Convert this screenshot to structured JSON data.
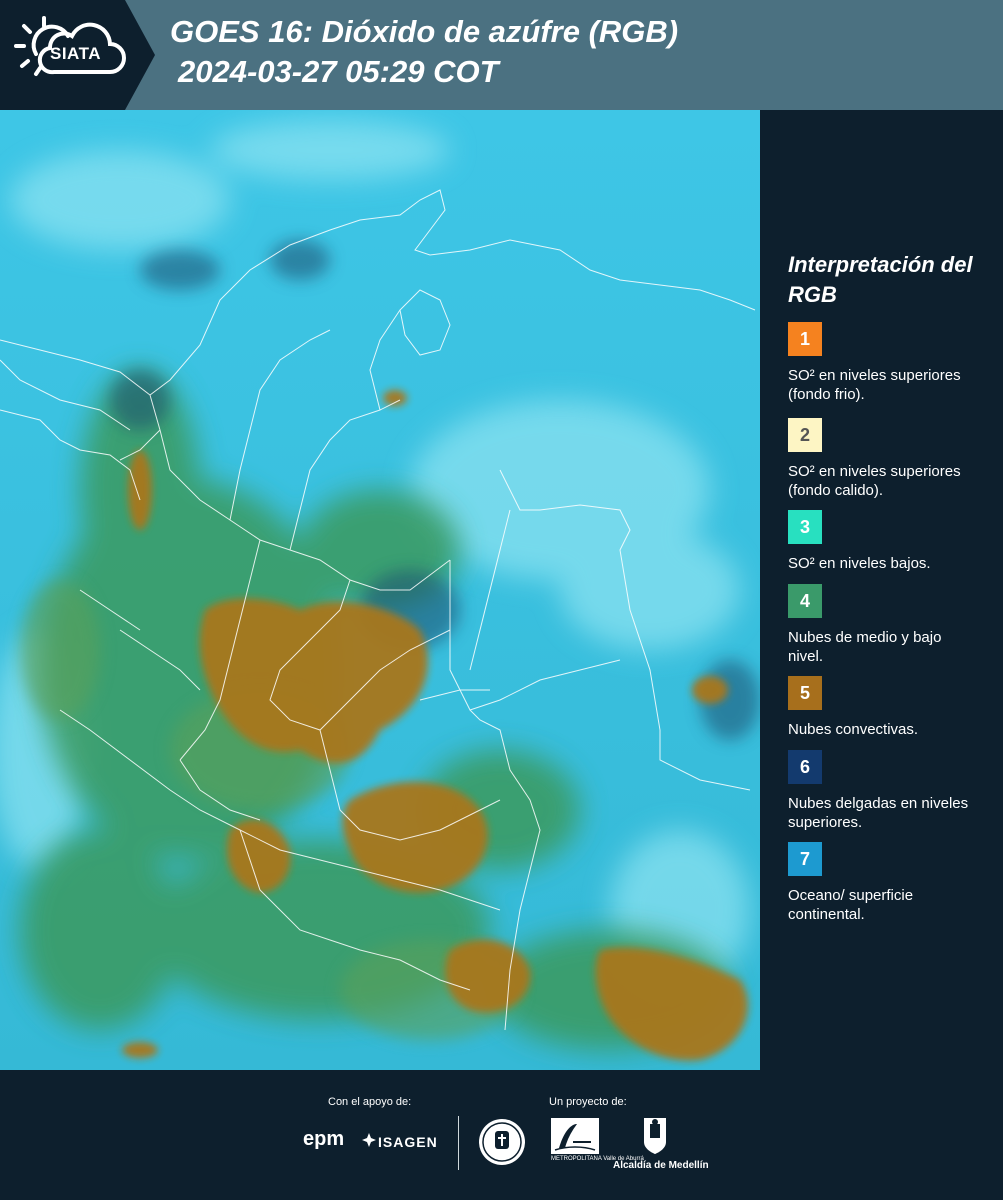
{
  "header": {
    "logo_text": "SIATA",
    "title": "GOES 16: Dióxido de azúfre (RGB)",
    "subtitle": " 2024-03-27 05:29 COT"
  },
  "legend": {
    "title": "Interpretación del RGB",
    "items": [
      {
        "number": "1",
        "label": "SO² en niveles superiores (fondo frio).",
        "color": "#f5821f",
        "text_color": "#ffffff"
      },
      {
        "number": "2",
        "label": "SO² en niveles superiores (fondo calido).",
        "color": "#fdf5c4",
        "text_color": "#555555"
      },
      {
        "number": "3",
        "label": "SO² en niveles bajos.",
        "color": "#28e0c0",
        "text_color": "#ffffff"
      },
      {
        "number": "4",
        "label": "Nubes de medio y bajo nivel.",
        "color": "#3a9a6a",
        "text_color": "#ffffff"
      },
      {
        "number": "5",
        "label": "Nubes convectivas.",
        "color": "#a76f1c",
        "text_color": "#ffffff"
      },
      {
        "number": "6",
        "label": "Nubes delgadas en niveles superiores.",
        "color": "#133a6e",
        "text_color": "#ffffff"
      },
      {
        "number": "7",
        "label": "Oceano/ superficie continental.",
        "color": "#1d9ad0",
        "text_color": "#ffffff"
      }
    ]
  },
  "footer": {
    "support_label": "Con el apoyo de:",
    "project_label": "Un proyecto de:",
    "epm": "epm",
    "isagen": "ISAGEN",
    "area_sub": "METROPOLITANA Valle de Aburrá",
    "alcaldia": "Alcaldía de Medellín"
  }
}
